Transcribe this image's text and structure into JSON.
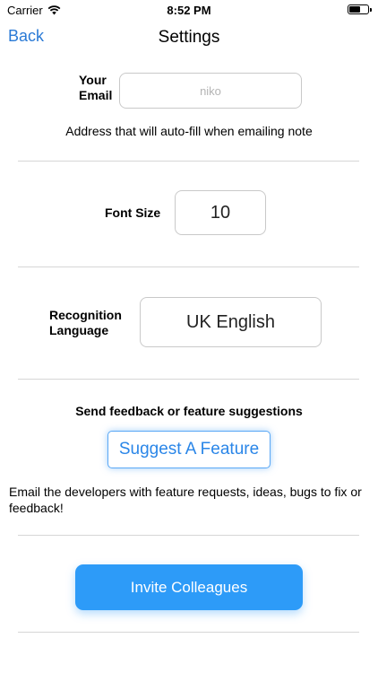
{
  "status_bar": {
    "carrier": "Carrier",
    "time": "8:52 PM"
  },
  "nav": {
    "back_label": "Back",
    "title": "Settings"
  },
  "email": {
    "label_line1": "Your",
    "label_line2": "Email",
    "placeholder": "niko",
    "note": "Address that will auto-fill when emailing note"
  },
  "font_size": {
    "label": "Font Size",
    "value": "10"
  },
  "recognition": {
    "label_line1": "Recognition",
    "label_line2": "Language",
    "value": "UK English"
  },
  "feedback": {
    "heading": "Send feedback or feature suggestions",
    "button_label": "Suggest A Feature",
    "description": "Email the developers with feature requests, ideas, bugs to fix or feedback!"
  },
  "invite": {
    "button_label": "Invite Colleagues"
  },
  "colors": {
    "accent": "#2a7ad6",
    "button_blue": "#2d9bf8",
    "divider": "#d6d6d6"
  }
}
